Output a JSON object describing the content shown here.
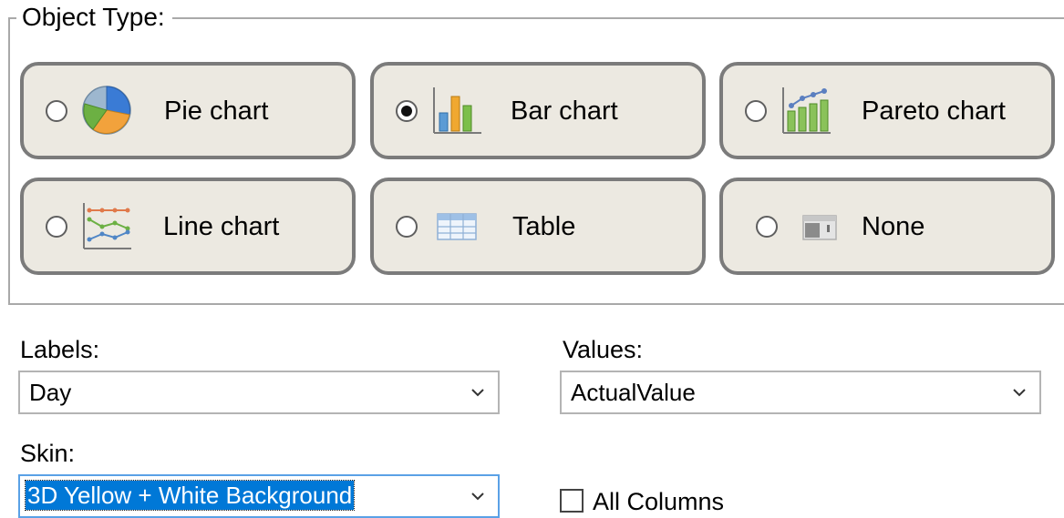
{
  "object_type": {
    "title": "Object Type:",
    "options": [
      {
        "label": "Pie chart",
        "icon": "pie-chart-icon",
        "selected": false
      },
      {
        "label": "Bar chart",
        "icon": "bar-chart-icon",
        "selected": true
      },
      {
        "label": "Pareto chart",
        "icon": "pareto-chart-icon",
        "selected": false
      },
      {
        "label": "Line chart",
        "icon": "line-chart-icon",
        "selected": false
      },
      {
        "label": "Table",
        "icon": "table-icon",
        "selected": false
      },
      {
        "label": "None",
        "icon": "none-icon",
        "selected": false
      }
    ]
  },
  "labels": {
    "label": "Labels:",
    "value": "Day"
  },
  "values": {
    "label": "Values:",
    "value": "ActualValue"
  },
  "skin": {
    "label": "Skin:",
    "value": "3D Yellow + White Background"
  },
  "all_columns": {
    "label": "All Columns",
    "checked": false
  },
  "colors": {
    "tile_background": "#ece9e1",
    "tile_border": "#7b7b7b",
    "selection": "#0078d7",
    "focus_border": "#5aa1e6"
  }
}
